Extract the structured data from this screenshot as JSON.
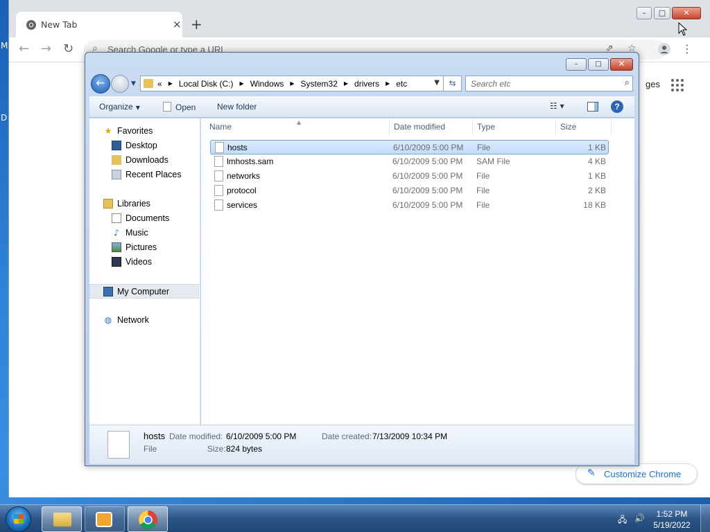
{
  "desktop": {
    "edge_glyph_1": "M",
    "edge_glyph_2": "D"
  },
  "chrome": {
    "tab_title": "New Tab",
    "tab_close": "×",
    "new_tab": "+",
    "omnibox_placeholder": "Search Google or type a URL",
    "images_link": "ges",
    "customize_label": "Customize Chrome"
  },
  "explorer": {
    "breadcrumb": [
      "«",
      "Local Disk (C:)",
      "Windows",
      "System32",
      "drivers",
      "etc"
    ],
    "search_placeholder": "Search etc",
    "commands": {
      "organize": "Organize",
      "open": "Open",
      "new_folder": "New folder"
    },
    "nav": {
      "favorites": "Favorites",
      "desktop": "Desktop",
      "downloads": "Downloads",
      "recent_places": "Recent Places",
      "libraries": "Libraries",
      "documents": "Documents",
      "music": "Music",
      "pictures": "Pictures",
      "videos": "Videos",
      "my_computer": "My Computer",
      "network": "Network"
    },
    "columns": {
      "name": "Name",
      "date_modified": "Date modified",
      "type": "Type",
      "size": "Size"
    },
    "files": [
      {
        "name": "hosts",
        "date": "6/10/2009 5:00 PM",
        "type": "File",
        "size": "1 KB",
        "selected": true
      },
      {
        "name": "lmhosts.sam",
        "date": "6/10/2009 5:00 PM",
        "type": "SAM File",
        "size": "4 KB",
        "selected": false
      },
      {
        "name": "networks",
        "date": "6/10/2009 5:00 PM",
        "type": "File",
        "size": "1 KB",
        "selected": false
      },
      {
        "name": "protocol",
        "date": "6/10/2009 5:00 PM",
        "type": "File",
        "size": "2 KB",
        "selected": false
      },
      {
        "name": "services",
        "date": "6/10/2009 5:00 PM",
        "type": "File",
        "size": "18 KB",
        "selected": false
      }
    ],
    "details": {
      "name": "hosts",
      "kind": "File",
      "date_modified_label": "Date modified:",
      "date_modified": "6/10/2009 5:00 PM",
      "date_created_label": "Date created:",
      "date_created": "7/13/2009 10:34 PM",
      "size_label": "Size:",
      "size": "824 bytes"
    }
  },
  "taskbar": {
    "time": "1:52 PM",
    "date": "5/19/2022"
  },
  "colors": {
    "chrome_tabstrip": "#dee1e6",
    "selection": "#c1dcfc",
    "accent_blue": "#1a73e8"
  }
}
